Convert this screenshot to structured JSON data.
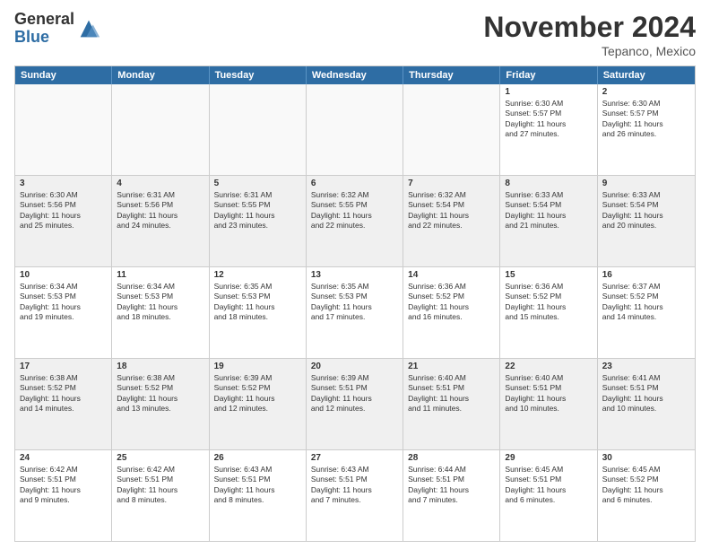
{
  "logo": {
    "general": "General",
    "blue": "Blue"
  },
  "title": "November 2024",
  "location": "Tepanco, Mexico",
  "header_days": [
    "Sunday",
    "Monday",
    "Tuesday",
    "Wednesday",
    "Thursday",
    "Friday",
    "Saturday"
  ],
  "rows": [
    [
      {
        "day": "",
        "info": ""
      },
      {
        "day": "",
        "info": ""
      },
      {
        "day": "",
        "info": ""
      },
      {
        "day": "",
        "info": ""
      },
      {
        "day": "",
        "info": ""
      },
      {
        "day": "1",
        "info": "Sunrise: 6:30 AM\nSunset: 5:57 PM\nDaylight: 11 hours\nand 27 minutes."
      },
      {
        "day": "2",
        "info": "Sunrise: 6:30 AM\nSunset: 5:57 PM\nDaylight: 11 hours\nand 26 minutes."
      }
    ],
    [
      {
        "day": "3",
        "info": "Sunrise: 6:30 AM\nSunset: 5:56 PM\nDaylight: 11 hours\nand 25 minutes."
      },
      {
        "day": "4",
        "info": "Sunrise: 6:31 AM\nSunset: 5:56 PM\nDaylight: 11 hours\nand 24 minutes."
      },
      {
        "day": "5",
        "info": "Sunrise: 6:31 AM\nSunset: 5:55 PM\nDaylight: 11 hours\nand 23 minutes."
      },
      {
        "day": "6",
        "info": "Sunrise: 6:32 AM\nSunset: 5:55 PM\nDaylight: 11 hours\nand 22 minutes."
      },
      {
        "day": "7",
        "info": "Sunrise: 6:32 AM\nSunset: 5:54 PM\nDaylight: 11 hours\nand 22 minutes."
      },
      {
        "day": "8",
        "info": "Sunrise: 6:33 AM\nSunset: 5:54 PM\nDaylight: 11 hours\nand 21 minutes."
      },
      {
        "day": "9",
        "info": "Sunrise: 6:33 AM\nSunset: 5:54 PM\nDaylight: 11 hours\nand 20 minutes."
      }
    ],
    [
      {
        "day": "10",
        "info": "Sunrise: 6:34 AM\nSunset: 5:53 PM\nDaylight: 11 hours\nand 19 minutes."
      },
      {
        "day": "11",
        "info": "Sunrise: 6:34 AM\nSunset: 5:53 PM\nDaylight: 11 hours\nand 18 minutes."
      },
      {
        "day": "12",
        "info": "Sunrise: 6:35 AM\nSunset: 5:53 PM\nDaylight: 11 hours\nand 18 minutes."
      },
      {
        "day": "13",
        "info": "Sunrise: 6:35 AM\nSunset: 5:53 PM\nDaylight: 11 hours\nand 17 minutes."
      },
      {
        "day": "14",
        "info": "Sunrise: 6:36 AM\nSunset: 5:52 PM\nDaylight: 11 hours\nand 16 minutes."
      },
      {
        "day": "15",
        "info": "Sunrise: 6:36 AM\nSunset: 5:52 PM\nDaylight: 11 hours\nand 15 minutes."
      },
      {
        "day": "16",
        "info": "Sunrise: 6:37 AM\nSunset: 5:52 PM\nDaylight: 11 hours\nand 14 minutes."
      }
    ],
    [
      {
        "day": "17",
        "info": "Sunrise: 6:38 AM\nSunset: 5:52 PM\nDaylight: 11 hours\nand 14 minutes."
      },
      {
        "day": "18",
        "info": "Sunrise: 6:38 AM\nSunset: 5:52 PM\nDaylight: 11 hours\nand 13 minutes."
      },
      {
        "day": "19",
        "info": "Sunrise: 6:39 AM\nSunset: 5:52 PM\nDaylight: 11 hours\nand 12 minutes."
      },
      {
        "day": "20",
        "info": "Sunrise: 6:39 AM\nSunset: 5:51 PM\nDaylight: 11 hours\nand 12 minutes."
      },
      {
        "day": "21",
        "info": "Sunrise: 6:40 AM\nSunset: 5:51 PM\nDaylight: 11 hours\nand 11 minutes."
      },
      {
        "day": "22",
        "info": "Sunrise: 6:40 AM\nSunset: 5:51 PM\nDaylight: 11 hours\nand 10 minutes."
      },
      {
        "day": "23",
        "info": "Sunrise: 6:41 AM\nSunset: 5:51 PM\nDaylight: 11 hours\nand 10 minutes."
      }
    ],
    [
      {
        "day": "24",
        "info": "Sunrise: 6:42 AM\nSunset: 5:51 PM\nDaylight: 11 hours\nand 9 minutes."
      },
      {
        "day": "25",
        "info": "Sunrise: 6:42 AM\nSunset: 5:51 PM\nDaylight: 11 hours\nand 8 minutes."
      },
      {
        "day": "26",
        "info": "Sunrise: 6:43 AM\nSunset: 5:51 PM\nDaylight: 11 hours\nand 8 minutes."
      },
      {
        "day": "27",
        "info": "Sunrise: 6:43 AM\nSunset: 5:51 PM\nDaylight: 11 hours\nand 7 minutes."
      },
      {
        "day": "28",
        "info": "Sunrise: 6:44 AM\nSunset: 5:51 PM\nDaylight: 11 hours\nand 7 minutes."
      },
      {
        "day": "29",
        "info": "Sunrise: 6:45 AM\nSunset: 5:51 PM\nDaylight: 11 hours\nand 6 minutes."
      },
      {
        "day": "30",
        "info": "Sunrise: 6:45 AM\nSunset: 5:52 PM\nDaylight: 11 hours\nand 6 minutes."
      }
    ]
  ]
}
